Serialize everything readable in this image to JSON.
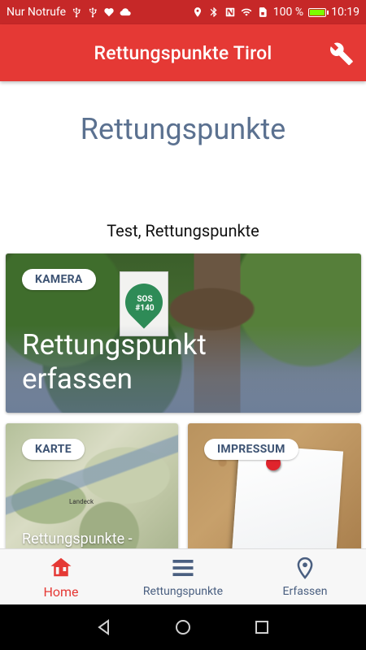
{
  "status_bar": {
    "carrier": "Nur Notrufe",
    "battery": "100 %",
    "battery_level": 1.0,
    "time": "10:19"
  },
  "app_bar": {
    "title": "Rettungspunkte Tirol",
    "settings_icon": "wrench-icon"
  },
  "main": {
    "heading": "Rettungspunkte",
    "subtitle": "Test, Rettungspunkte"
  },
  "cards": {
    "camera": {
      "chip": "KAMERA",
      "title_line1": "Rettungspunkt",
      "title_line2": "erfassen",
      "sign_text": "SOS #140"
    },
    "map": {
      "chip": "KARTE",
      "title": "Rettungspunkte -",
      "place_label": "Landeck"
    },
    "impressum": {
      "chip": "IMPRESSUM"
    }
  },
  "bottom_nav": {
    "items": [
      {
        "label": "Home",
        "icon": "home-icon",
        "active": true
      },
      {
        "label": "Rettungspunkte",
        "icon": "list-icon",
        "active": false
      },
      {
        "label": "Erfassen",
        "icon": "location-pin-icon",
        "active": false
      }
    ]
  },
  "colors": {
    "app_bar": "#e53935",
    "status_bar": "#c62828",
    "heading": "#5b7190",
    "nav_active": "#e53935",
    "nav_inactive": "#4a5f80"
  }
}
